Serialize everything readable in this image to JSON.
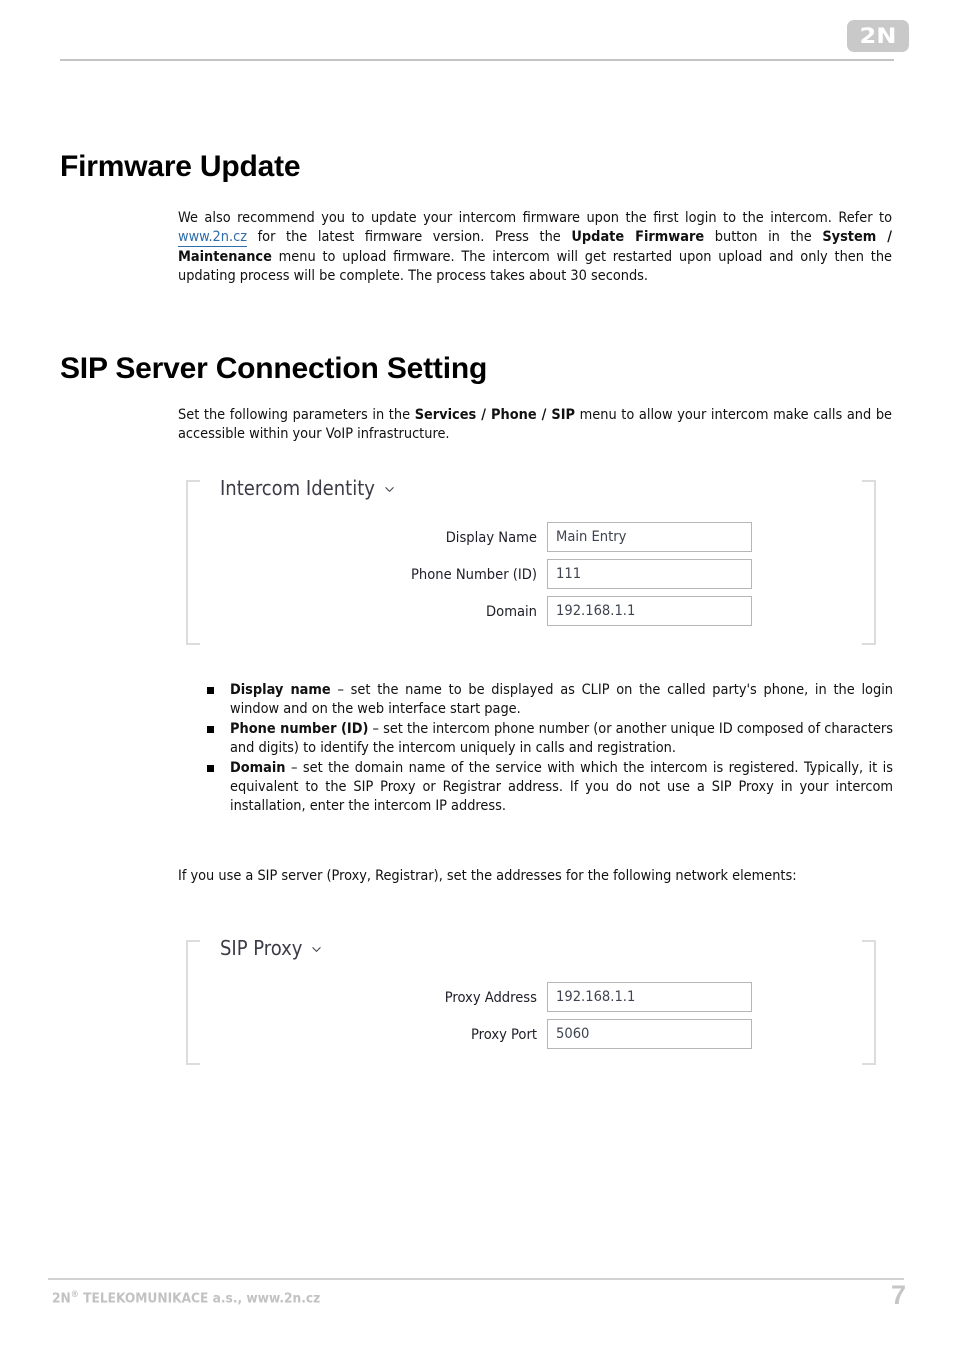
{
  "header": {
    "logo_text": "2N",
    "logo_name": "2n-logo"
  },
  "sections": [
    {
      "heading": "Firmware Update",
      "paragraph_parts": [
        {
          "t": "We also recommend you to update your intercom firmware upon the first login to the intercom. Refer to ",
          "s": "normal"
        },
        {
          "t": "www.2n.cz",
          "s": "link"
        },
        {
          "t": "  for the latest firmware version. Press the ",
          "s": "normal"
        },
        {
          "t": "Update Firmware",
          "s": "bold"
        },
        {
          "t": " button in the ",
          "s": "normal"
        },
        {
          "t": "System / Maintenance",
          "s": "bold"
        },
        {
          "t": " menu to upload firmware. The intercom will get restarted upon upload and only then the updating process will be complete. The process takes about 30 seconds.",
          "s": "normal"
        }
      ]
    },
    {
      "heading": "SIP Server Connection Setting",
      "paragraph_parts": [
        {
          "t": "Set the following parameters in the ",
          "s": "normal"
        },
        {
          "t": "Services / Phone / SIP",
          "s": "bold"
        },
        {
          "t": " menu to allow your intercom make calls and be accessible within your VoIP infrastructure.",
          "s": "normal"
        }
      ]
    }
  ],
  "panel_identity": {
    "title": "Intercom Identity",
    "chevron_icon": "chevron-down-icon",
    "rows": [
      {
        "label": "Display Name",
        "value": "Main Entry"
      },
      {
        "label": "Phone Number (ID)",
        "value": "111"
      },
      {
        "label": "Domain",
        "value": "192.168.1.1"
      }
    ]
  },
  "bullets": [
    [
      {
        "t": "Display name",
        "s": "bold"
      },
      {
        "t": " – set the name to be displayed as CLIP on the called party's phone, in the login window and on the web interface start page.",
        "s": "normal"
      }
    ],
    [
      {
        "t": "Phone number (ID)",
        "s": "bold"
      },
      {
        "t": " – set the intercom phone number (or another unique ID composed of characters and digits) to identify the intercom uniquely in calls and registration.",
        "s": "normal"
      }
    ],
    [
      {
        "t": "Domain",
        "s": "bold"
      },
      {
        "t": " – set the domain name of the service with which the intercom is registered. Typically, it is equivalent to the SIP Proxy or Registrar address. If you do not use a SIP Proxy in your intercom installation, enter the intercom IP address.",
        "s": "normal"
      }
    ]
  ],
  "proxy_note": [
    {
      "t": "If you use a SIP server (Proxy, Registrar), set the addresses for the following network elements:",
      "s": "normal"
    }
  ],
  "panel_proxy": {
    "title": "SIP Proxy",
    "chevron_icon": "chevron-down-icon",
    "rows": [
      {
        "label": "Proxy Address",
        "value": "192.168.1.1"
      },
      {
        "label": "Proxy Port",
        "value": "5060"
      }
    ]
  },
  "footer": {
    "company_prefix": "2N",
    "registered_mark": "®",
    "company_rest": " TELEKOMUNIKACE a.s., www.2n.cz",
    "page_number": "7"
  },
  "colors": {
    "link": "#2e6da8",
    "rule": "#c4c4c4",
    "footer_gray": "#c2c2c2",
    "panel_bracket": "#dcdcdc",
    "input_border": "#b6b6b6",
    "input_text": "#3e4450",
    "panel_title": "#3c3c46"
  }
}
